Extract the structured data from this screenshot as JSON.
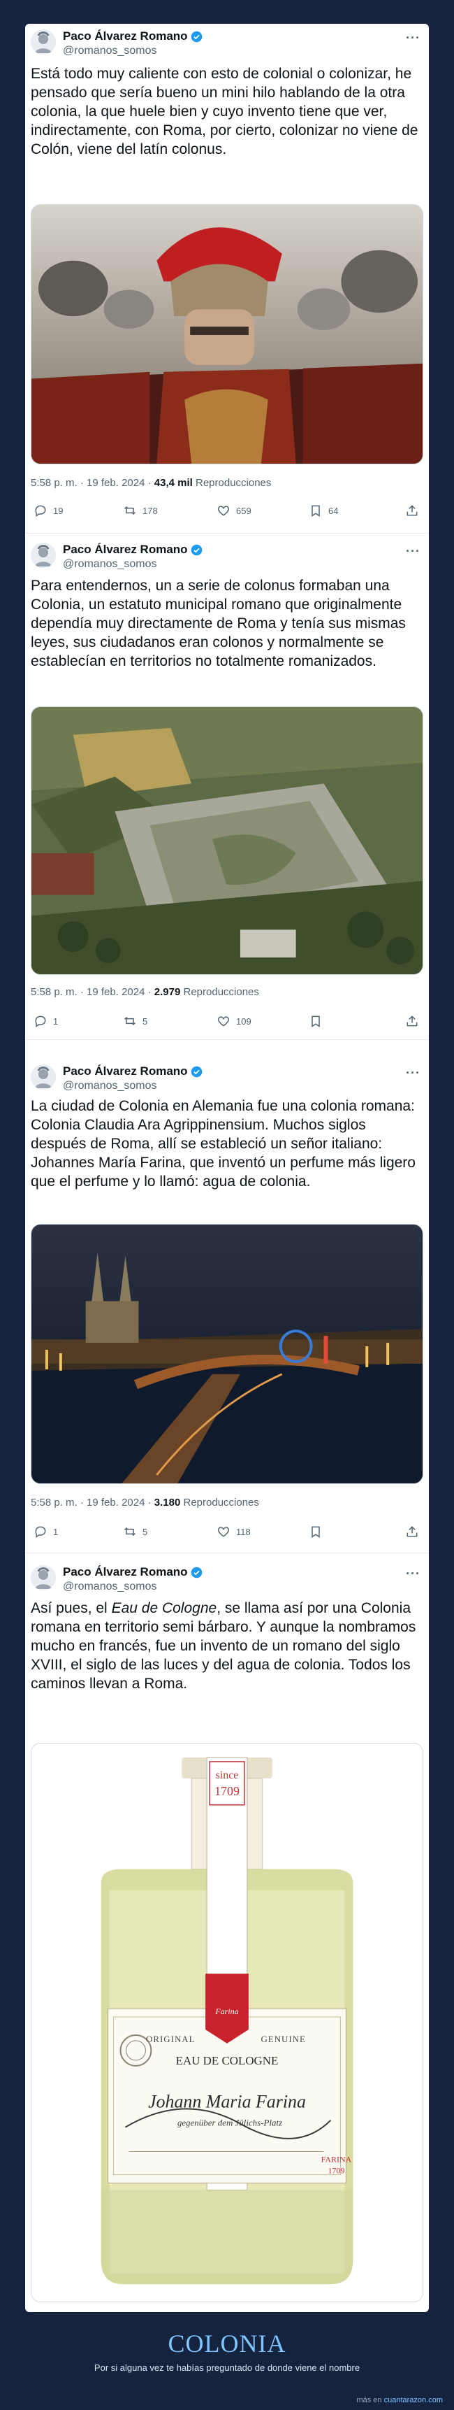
{
  "tweets": [
    {
      "name": "Paco Álvarez Romano",
      "handle": "@romanos_somos",
      "text": "Está todo muy caliente con esto de colonial o colonizar, he pensado que sería bueno un mini hilo hablando de la otra colonia, la que huele bien y cuyo invento tiene que ver, indirectamente, con Roma, por cierto, colonizar no viene de Colón, viene del latín colonus.",
      "time": "5:58 p. m. · 19 feb. 2024 ·",
      "views": "43,4 mil",
      "views_label": "Reproducciones",
      "replies": "19",
      "reposts": "178",
      "likes": "659",
      "bookmarks": "64"
    },
    {
      "name": "Paco Álvarez Romano",
      "handle": "@romanos_somos",
      "text": "Para entendernos, un a serie de colonus formaban una Colonia, un estatuto municipal romano que originalmente dependía muy directamente de Roma y tenía sus mismas leyes, sus ciudadanos eran colonos y normalmente se establecían en territorios no totalmente romanizados.",
      "time": "5:58 p. m. · 19 feb. 2024 ·",
      "views": "2.979",
      "views_label": "Reproducciones",
      "replies": "1",
      "reposts": "5",
      "likes": "109",
      "bookmarks": ""
    },
    {
      "name": "Paco Álvarez Romano",
      "handle": "@romanos_somos",
      "text": "La ciudad de Colonia en Alemania fue una colonia romana: Colonia Claudia Ara Agrippinensium. Muchos siglos después de Roma, allí se estableció un señor italiano: Johannes María Farina, que inventó un perfume más ligero que el perfume y lo llamó: agua de colonia.",
      "time": "5:58 p. m. · 19 feb. 2024 ·",
      "views": "3.180",
      "views_label": "Reproducciones",
      "replies": "1",
      "reposts": "5",
      "likes": "118",
      "bookmarks": ""
    },
    {
      "name": "Paco Álvarez Romano",
      "handle": "@romanos_somos",
      "text_before": "Así pues, el ",
      "text_em": "Eau de Cologne",
      "text_after": ", se llama así por una Colonia romana en territorio semi bárbaro. Y aunque la nombramos mucho en francés, fue un invento de un romano del siglo XVIII, el siglo de las luces y del agua de colonia. Todos los caminos llevan a Roma."
    }
  ],
  "bottle_label": {
    "since": "since",
    "year": "1709",
    "original": "ORIGINAL",
    "genuine": "GENUINE",
    "eau": "EAU DE COLOGNE",
    "signature": "Johann Maria Farina",
    "signature_sub": "gegenüber dem Jülichs-Platz",
    "farina_brand": "FARINA",
    "farina_year": "1709",
    "seal_text": "Farina"
  },
  "footer": {
    "title": "COLONIA",
    "subtitle": "Por si alguna vez te habías preguntado de donde viene el nombre",
    "credit_prefix": "más en",
    "credit_link": "cuantarazon.com"
  },
  "colors": {
    "background": "#14243f",
    "verified": "#1d9bf0",
    "footer_title": "#7fc3ff"
  },
  "icons": [
    "reply-icon",
    "repost-icon",
    "like-icon",
    "bookmark-icon",
    "share-icon",
    "verified-icon",
    "more-icon"
  ]
}
